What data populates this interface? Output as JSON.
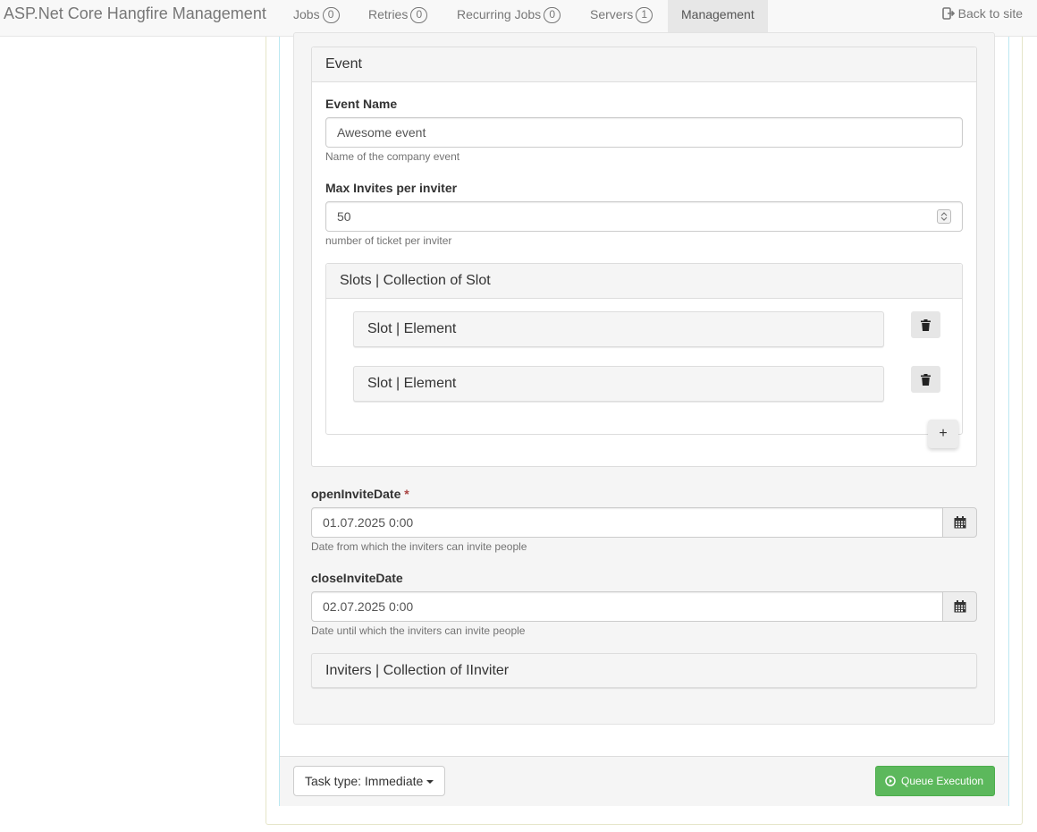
{
  "navbar": {
    "brand": "ASP.Net Core Hangfire Management",
    "items": [
      {
        "label": "Jobs",
        "count": "0"
      },
      {
        "label": "Retries",
        "count": "0"
      },
      {
        "label": "Recurring Jobs",
        "count": "0"
      },
      {
        "label": "Servers",
        "count": "1"
      },
      {
        "label": "Management"
      }
    ],
    "active": "Management",
    "back_link": "Back to site"
  },
  "event_panel": {
    "title": "Event",
    "event_name": {
      "label": "Event Name",
      "value": "Awesome event",
      "help": "Name of the company event"
    },
    "max_invites": {
      "label": "Max Invites per inviter",
      "value": "50",
      "help": "number of ticket per inviter"
    },
    "slots": {
      "title": "Slots | Collection of Slot",
      "items": [
        {
          "label": "Slot | Element"
        },
        {
          "label": "Slot | Element"
        }
      ],
      "add_label": "+"
    }
  },
  "open_invite_date": {
    "label": "openInviteDate",
    "required_mark": "*",
    "value": "01.07.2025 0:00",
    "help": "Date from which the inviters can invite people"
  },
  "close_invite_date": {
    "label": "closeInviteDate",
    "value": "02.07.2025 0:00",
    "help": "Date until which the inviters can invite people"
  },
  "inviters": {
    "title": "Inviters | Collection of IInviter"
  },
  "footer": {
    "task_type_label": "Task type: Immediate",
    "queue_button": "Queue Execution"
  },
  "colors": {
    "success": "#5cb85c",
    "required": "#a94442",
    "navbar_bg": "#f8f8f8"
  }
}
